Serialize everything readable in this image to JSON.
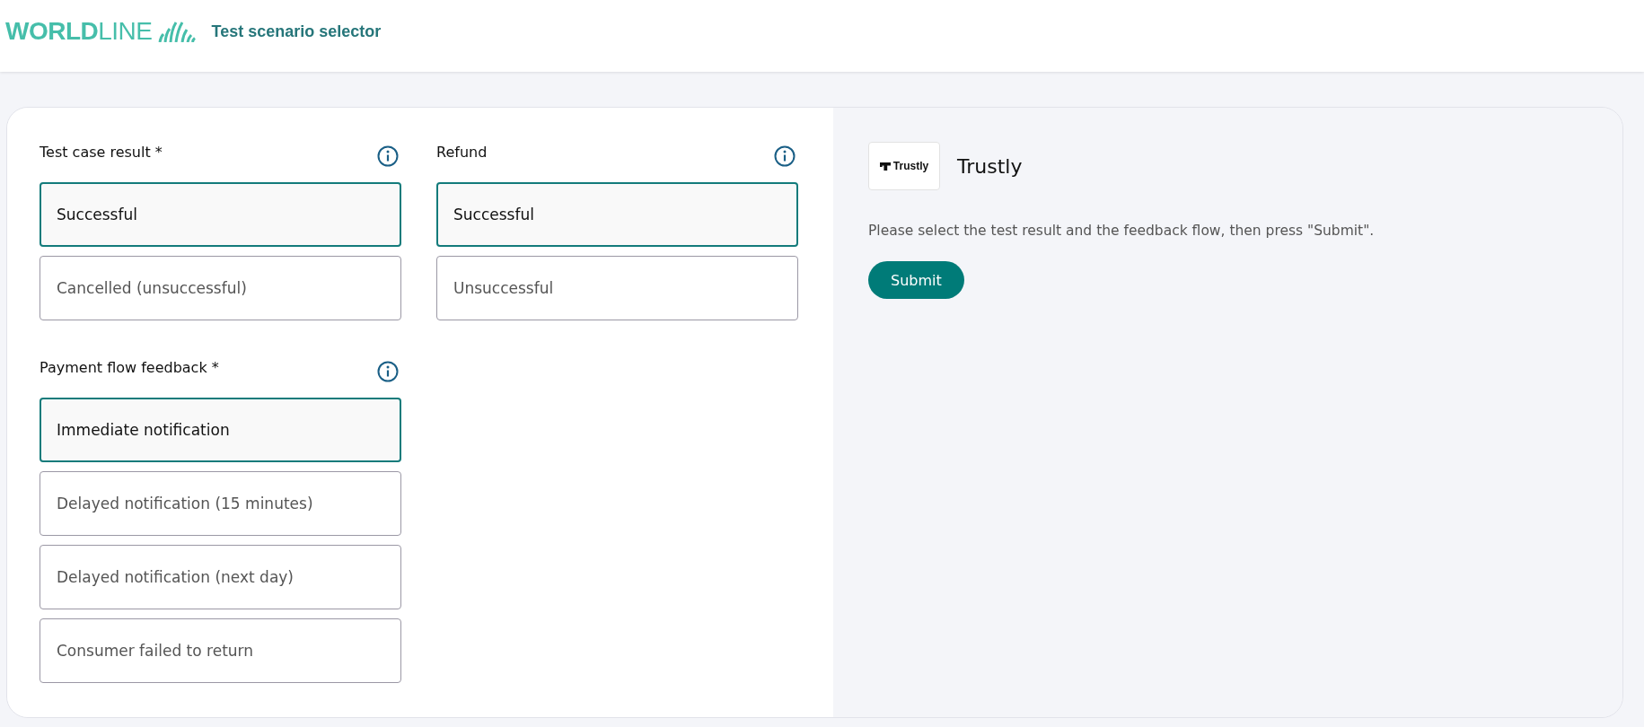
{
  "header": {
    "logo": "**WORLD**LINE",
    "title": "Test scenario selector"
  },
  "groups": [
    {
      "label": "Test case result *",
      "options": [
        {
          "label": "Successful",
          "selected": true
        },
        {
          "label": "Cancelled (unsuccessful)",
          "selected": false
        }
      ]
    },
    {
      "label": "Refund",
      "options": [
        {
          "label": "Successful",
          "selected": true
        },
        {
          "label": "Unsuccessful",
          "selected": false
        }
      ]
    },
    {
      "label": "Payment flow feedback *",
      "options": [
        {
          "label": "Immediate notification",
          "selected": true
        },
        {
          "label": "Delayed notification (15 minutes)",
          "selected": false
        },
        {
          "label": "Delayed notification (next day)",
          "selected": false
        },
        {
          "label": "Consumer failed to return",
          "selected": false
        }
      ]
    }
  ],
  "provider": {
    "logo_text": "Trustly",
    "name": "Trustly",
    "instructions": "Please select the test result and the feedback flow, then press \"Submit\".",
    "submit": "Submit"
  }
}
